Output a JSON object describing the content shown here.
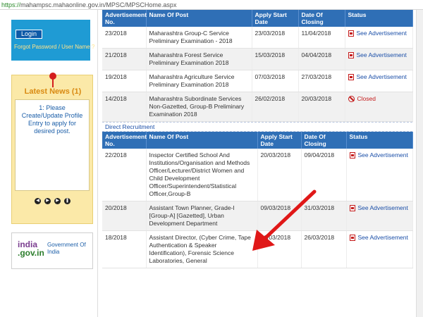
{
  "browser": {
    "url_scheme": "https://",
    "url_rest": "mahampsc.mahaonline.gov.in/MPSC/MPSCHome.aspx"
  },
  "sidebar": {
    "login_label": "Login",
    "forgot_label": "Forgot Password / User Name ?",
    "news_title": "Latest News (1)",
    "news_item": "1: Please Create/Update Profile Entry to apply for desired post.",
    "gov_logo_india": "india",
    "gov_logo_gov": ".gov.in",
    "gov_text": "Government Of India"
  },
  "headers": {
    "adv_no": "Advertisement No.",
    "post": "Name Of Post",
    "apply_start": "Apply Start Date",
    "closing": "Date Of Closing",
    "status": "Status"
  },
  "rows_top": [
    {
      "adv": "23/2018",
      "post": "Maharashtra Group-C Service Preliminary Examination - 2018",
      "start": "23/03/2018",
      "close": "11/04/2018",
      "status": "See Advertisement",
      "state": "open"
    },
    {
      "adv": "21/2018",
      "post": "Maharashtra Forest Service Preliminary Examination 2018",
      "start": "15/03/2018",
      "close": "04/04/2018",
      "status": "See Advertisement",
      "state": "open"
    },
    {
      "adv": "19/2018",
      "post": "Maharashtra Agriculture Service Preliminary Examination 2018",
      "start": "07/03/2018",
      "close": "27/03/2018",
      "status": "See Advertisement",
      "state": "open"
    },
    {
      "adv": "14/2018",
      "post": "Maharashtra Subordinate Services Non-Gazetted, Group-B Preliminary Examination 2018",
      "start": "26/02/2018",
      "close": "20/03/2018",
      "status": "Closed",
      "state": "closed"
    }
  ],
  "section_direct": "Direct Recruitment",
  "rows_direct": [
    {
      "adv": "22/2018",
      "post": "Inspector Certified School And Institutions/Organisation and Methods Officer/Lecturer/District Women and Child Development Officer/Superintendent/Statistical Officer,Group-B",
      "start": "20/03/2018",
      "close": "09/04/2018",
      "status": "See Advertisement",
      "state": "open"
    },
    {
      "adv": "20/2018",
      "post": "Assistant Town Planner, Grade-I [Group-A] [Gazetted], Urban Development Department",
      "start": "09/03/2018",
      "close": "31/03/2018",
      "status": "See Advertisement",
      "state": "open"
    },
    {
      "adv": "18/2018",
      "post": "Assistant Director, (Cyber Crime, Tape Authentication & Speaker Identification), Forensic Science Laboratories, General",
      "start": "06/03/2018",
      "close": "26/03/2018",
      "status": "See Advertisement",
      "state": "open"
    }
  ],
  "colors": {
    "header_blue": "#2f6fb6",
    "link_blue": "#1b4fa8",
    "closed_red": "#c41a1a",
    "arrow_red": "#e01818"
  }
}
